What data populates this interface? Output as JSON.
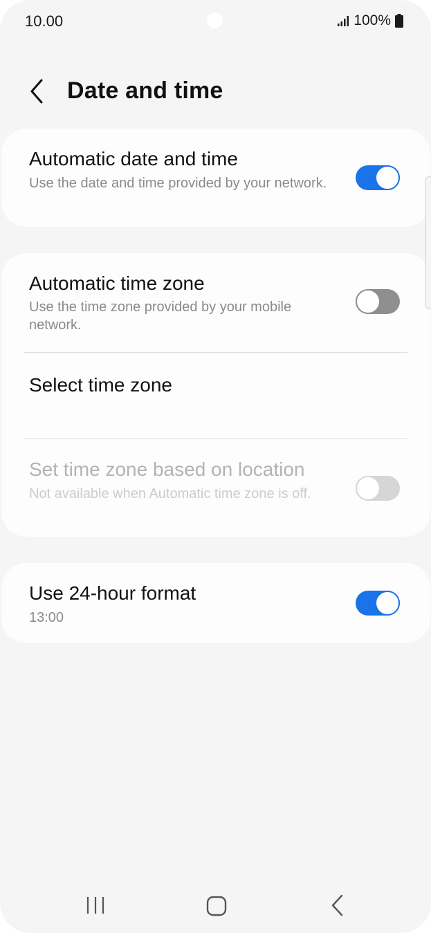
{
  "status_bar": {
    "time": "10.00",
    "battery": "100%"
  },
  "header": {
    "title": "Date and time"
  },
  "settings": {
    "automatic_date_time": {
      "title": "Automatic date and time",
      "subtitle": "Use the date and time provided by your network.",
      "enabled": true
    },
    "automatic_time_zone": {
      "title": "Automatic time zone",
      "subtitle": "Use the time zone provided by your mobile network.",
      "enabled": false
    },
    "select_time_zone": {
      "title": "Select time zone"
    },
    "time_zone_location": {
      "title": "Set time zone based on location",
      "subtitle": "Not available when Automatic time zone is off.",
      "enabled": false,
      "available": false
    },
    "use_24_hour": {
      "title": "Use 24-hour format",
      "subtitle": "13:00",
      "enabled": true
    }
  },
  "colors": {
    "accent": "#1a73e8",
    "background": "#f5f5f5",
    "card": "#fdfdfd"
  }
}
